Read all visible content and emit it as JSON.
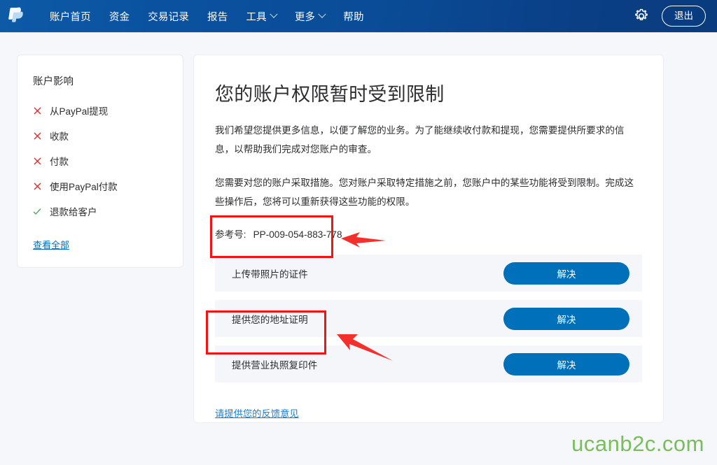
{
  "navbar": {
    "logo_icon": "paypal-logo-icon",
    "items": [
      {
        "label": "账户首页",
        "has_caret": false
      },
      {
        "label": "资金",
        "has_caret": false
      },
      {
        "label": "交易记录",
        "has_caret": false
      },
      {
        "label": "报告",
        "has_caret": false
      },
      {
        "label": "工具",
        "has_caret": true
      },
      {
        "label": "更多",
        "has_caret": true
      },
      {
        "label": "帮助",
        "has_caret": false
      }
    ],
    "settings_icon": "gear-icon",
    "logout_label": "退出"
  },
  "sidebar": {
    "title": "账户影响",
    "items": [
      {
        "label": "从PayPal提现",
        "status": "blocked",
        "mark": "✕"
      },
      {
        "label": "收款",
        "status": "blocked",
        "mark": "✕"
      },
      {
        "label": "付款",
        "status": "blocked",
        "mark": "✕"
      },
      {
        "label": "使用PayPal付款",
        "status": "blocked",
        "mark": "✕"
      },
      {
        "label": "退款给客户",
        "status": "allowed",
        "mark": "✓"
      }
    ],
    "view_all_label": "查看全部"
  },
  "main": {
    "title": "您的账户权限暂时受到限制",
    "paragraph1": "我们希望您提供更多信息，以便了解您的业务。为了能继续收付款和提现，您需要提供所要求的信息，以帮助我们完成对您账户的审查。",
    "paragraph2": "您需要对您的账户采取措施。您对账户采取特定措施之前，您账户中的某些功能将受到限制。完成这些操作后，您将可以重新获得这些功能的权限。",
    "reference_label": "参考号:",
    "reference_value": "PP-009-054-883-778",
    "actions": [
      {
        "label": "上传带照片的证件",
        "button_label": "解决",
        "annotated": true
      },
      {
        "label": "提供您的地址证明",
        "button_label": "解决",
        "annotated": false
      },
      {
        "label": "提供营业执照复印件",
        "button_label": "解决",
        "annotated": true
      }
    ],
    "feedback_label": "请提供您的反馈意见"
  },
  "watermark": "ucanb2c.com",
  "colors": {
    "nav_blue": "#0a52a0",
    "paypal_blue": "#0070ba",
    "annotation_red": "#f01515",
    "blocked_red": "#d9252a",
    "allowed_green": "#4a9c5e",
    "watermark_green": "#79bd5c",
    "row_bg": "#f4f6f9",
    "page_bg": "#f5f7fa"
  }
}
